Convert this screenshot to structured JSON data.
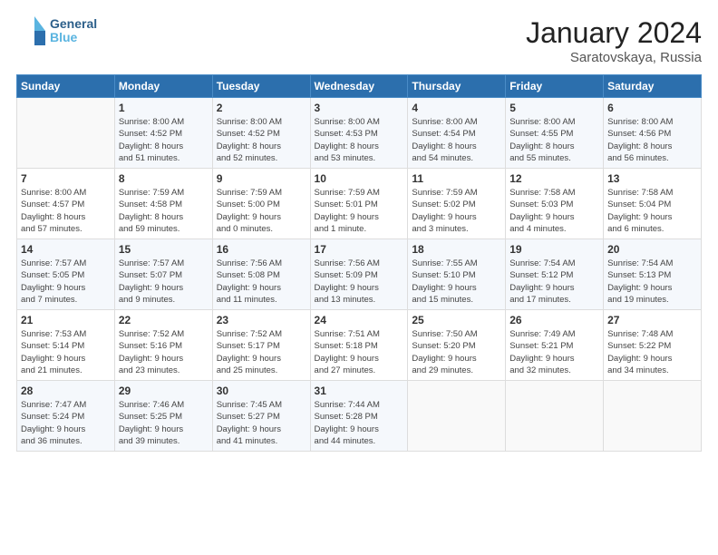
{
  "header": {
    "logo_line1": "General",
    "logo_line2": "Blue",
    "month": "January 2024",
    "location": "Saratovskaya, Russia"
  },
  "columns": [
    "Sunday",
    "Monday",
    "Tuesday",
    "Wednesday",
    "Thursday",
    "Friday",
    "Saturday"
  ],
  "rows": [
    [
      {
        "day": "",
        "info": ""
      },
      {
        "day": "1",
        "info": "Sunrise: 8:00 AM\nSunset: 4:52 PM\nDaylight: 8 hours\nand 51 minutes."
      },
      {
        "day": "2",
        "info": "Sunrise: 8:00 AM\nSunset: 4:52 PM\nDaylight: 8 hours\nand 52 minutes."
      },
      {
        "day": "3",
        "info": "Sunrise: 8:00 AM\nSunset: 4:53 PM\nDaylight: 8 hours\nand 53 minutes."
      },
      {
        "day": "4",
        "info": "Sunrise: 8:00 AM\nSunset: 4:54 PM\nDaylight: 8 hours\nand 54 minutes."
      },
      {
        "day": "5",
        "info": "Sunrise: 8:00 AM\nSunset: 4:55 PM\nDaylight: 8 hours\nand 55 minutes."
      },
      {
        "day": "6",
        "info": "Sunrise: 8:00 AM\nSunset: 4:56 PM\nDaylight: 8 hours\nand 56 minutes."
      }
    ],
    [
      {
        "day": "7",
        "info": "Sunrise: 8:00 AM\nSunset: 4:57 PM\nDaylight: 8 hours\nand 57 minutes."
      },
      {
        "day": "8",
        "info": "Sunrise: 7:59 AM\nSunset: 4:58 PM\nDaylight: 8 hours\nand 59 minutes."
      },
      {
        "day": "9",
        "info": "Sunrise: 7:59 AM\nSunset: 5:00 PM\nDaylight: 9 hours\nand 0 minutes."
      },
      {
        "day": "10",
        "info": "Sunrise: 7:59 AM\nSunset: 5:01 PM\nDaylight: 9 hours\nand 1 minute."
      },
      {
        "day": "11",
        "info": "Sunrise: 7:59 AM\nSunset: 5:02 PM\nDaylight: 9 hours\nand 3 minutes."
      },
      {
        "day": "12",
        "info": "Sunrise: 7:58 AM\nSunset: 5:03 PM\nDaylight: 9 hours\nand 4 minutes."
      },
      {
        "day": "13",
        "info": "Sunrise: 7:58 AM\nSunset: 5:04 PM\nDaylight: 9 hours\nand 6 minutes."
      }
    ],
    [
      {
        "day": "14",
        "info": "Sunrise: 7:57 AM\nSunset: 5:05 PM\nDaylight: 9 hours\nand 7 minutes."
      },
      {
        "day": "15",
        "info": "Sunrise: 7:57 AM\nSunset: 5:07 PM\nDaylight: 9 hours\nand 9 minutes."
      },
      {
        "day": "16",
        "info": "Sunrise: 7:56 AM\nSunset: 5:08 PM\nDaylight: 9 hours\nand 11 minutes."
      },
      {
        "day": "17",
        "info": "Sunrise: 7:56 AM\nSunset: 5:09 PM\nDaylight: 9 hours\nand 13 minutes."
      },
      {
        "day": "18",
        "info": "Sunrise: 7:55 AM\nSunset: 5:10 PM\nDaylight: 9 hours\nand 15 minutes."
      },
      {
        "day": "19",
        "info": "Sunrise: 7:54 AM\nSunset: 5:12 PM\nDaylight: 9 hours\nand 17 minutes."
      },
      {
        "day": "20",
        "info": "Sunrise: 7:54 AM\nSunset: 5:13 PM\nDaylight: 9 hours\nand 19 minutes."
      }
    ],
    [
      {
        "day": "21",
        "info": "Sunrise: 7:53 AM\nSunset: 5:14 PM\nDaylight: 9 hours\nand 21 minutes."
      },
      {
        "day": "22",
        "info": "Sunrise: 7:52 AM\nSunset: 5:16 PM\nDaylight: 9 hours\nand 23 minutes."
      },
      {
        "day": "23",
        "info": "Sunrise: 7:52 AM\nSunset: 5:17 PM\nDaylight: 9 hours\nand 25 minutes."
      },
      {
        "day": "24",
        "info": "Sunrise: 7:51 AM\nSunset: 5:18 PM\nDaylight: 9 hours\nand 27 minutes."
      },
      {
        "day": "25",
        "info": "Sunrise: 7:50 AM\nSunset: 5:20 PM\nDaylight: 9 hours\nand 29 minutes."
      },
      {
        "day": "26",
        "info": "Sunrise: 7:49 AM\nSunset: 5:21 PM\nDaylight: 9 hours\nand 32 minutes."
      },
      {
        "day": "27",
        "info": "Sunrise: 7:48 AM\nSunset: 5:22 PM\nDaylight: 9 hours\nand 34 minutes."
      }
    ],
    [
      {
        "day": "28",
        "info": "Sunrise: 7:47 AM\nSunset: 5:24 PM\nDaylight: 9 hours\nand 36 minutes."
      },
      {
        "day": "29",
        "info": "Sunrise: 7:46 AM\nSunset: 5:25 PM\nDaylight: 9 hours\nand 39 minutes."
      },
      {
        "day": "30",
        "info": "Sunrise: 7:45 AM\nSunset: 5:27 PM\nDaylight: 9 hours\nand 41 minutes."
      },
      {
        "day": "31",
        "info": "Sunrise: 7:44 AM\nSunset: 5:28 PM\nDaylight: 9 hours\nand 44 minutes."
      },
      {
        "day": "",
        "info": ""
      },
      {
        "day": "",
        "info": ""
      },
      {
        "day": "",
        "info": ""
      }
    ]
  ]
}
